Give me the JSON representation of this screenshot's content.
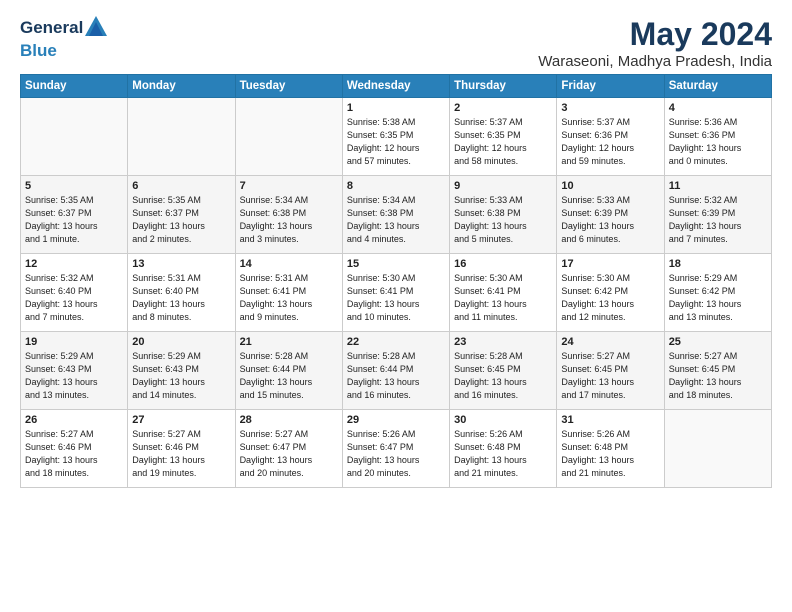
{
  "logo": {
    "line1": "General",
    "line2": "Blue"
  },
  "title": "May 2024",
  "location": "Waraseoni, Madhya Pradesh, India",
  "days_header": [
    "Sunday",
    "Monday",
    "Tuesday",
    "Wednesday",
    "Thursday",
    "Friday",
    "Saturday"
  ],
  "weeks": [
    [
      {
        "num": "",
        "info": ""
      },
      {
        "num": "",
        "info": ""
      },
      {
        "num": "",
        "info": ""
      },
      {
        "num": "1",
        "info": "Sunrise: 5:38 AM\nSunset: 6:35 PM\nDaylight: 12 hours\nand 57 minutes."
      },
      {
        "num": "2",
        "info": "Sunrise: 5:37 AM\nSunset: 6:35 PM\nDaylight: 12 hours\nand 58 minutes."
      },
      {
        "num": "3",
        "info": "Sunrise: 5:37 AM\nSunset: 6:36 PM\nDaylight: 12 hours\nand 59 minutes."
      },
      {
        "num": "4",
        "info": "Sunrise: 5:36 AM\nSunset: 6:36 PM\nDaylight: 13 hours\nand 0 minutes."
      }
    ],
    [
      {
        "num": "5",
        "info": "Sunrise: 5:35 AM\nSunset: 6:37 PM\nDaylight: 13 hours\nand 1 minute."
      },
      {
        "num": "6",
        "info": "Sunrise: 5:35 AM\nSunset: 6:37 PM\nDaylight: 13 hours\nand 2 minutes."
      },
      {
        "num": "7",
        "info": "Sunrise: 5:34 AM\nSunset: 6:38 PM\nDaylight: 13 hours\nand 3 minutes."
      },
      {
        "num": "8",
        "info": "Sunrise: 5:34 AM\nSunset: 6:38 PM\nDaylight: 13 hours\nand 4 minutes."
      },
      {
        "num": "9",
        "info": "Sunrise: 5:33 AM\nSunset: 6:38 PM\nDaylight: 13 hours\nand 5 minutes."
      },
      {
        "num": "10",
        "info": "Sunrise: 5:33 AM\nSunset: 6:39 PM\nDaylight: 13 hours\nand 6 minutes."
      },
      {
        "num": "11",
        "info": "Sunrise: 5:32 AM\nSunset: 6:39 PM\nDaylight: 13 hours\nand 7 minutes."
      }
    ],
    [
      {
        "num": "12",
        "info": "Sunrise: 5:32 AM\nSunset: 6:40 PM\nDaylight: 13 hours\nand 7 minutes."
      },
      {
        "num": "13",
        "info": "Sunrise: 5:31 AM\nSunset: 6:40 PM\nDaylight: 13 hours\nand 8 minutes."
      },
      {
        "num": "14",
        "info": "Sunrise: 5:31 AM\nSunset: 6:41 PM\nDaylight: 13 hours\nand 9 minutes."
      },
      {
        "num": "15",
        "info": "Sunrise: 5:30 AM\nSunset: 6:41 PM\nDaylight: 13 hours\nand 10 minutes."
      },
      {
        "num": "16",
        "info": "Sunrise: 5:30 AM\nSunset: 6:41 PM\nDaylight: 13 hours\nand 11 minutes."
      },
      {
        "num": "17",
        "info": "Sunrise: 5:30 AM\nSunset: 6:42 PM\nDaylight: 13 hours\nand 12 minutes."
      },
      {
        "num": "18",
        "info": "Sunrise: 5:29 AM\nSunset: 6:42 PM\nDaylight: 13 hours\nand 13 minutes."
      }
    ],
    [
      {
        "num": "19",
        "info": "Sunrise: 5:29 AM\nSunset: 6:43 PM\nDaylight: 13 hours\nand 13 minutes."
      },
      {
        "num": "20",
        "info": "Sunrise: 5:29 AM\nSunset: 6:43 PM\nDaylight: 13 hours\nand 14 minutes."
      },
      {
        "num": "21",
        "info": "Sunrise: 5:28 AM\nSunset: 6:44 PM\nDaylight: 13 hours\nand 15 minutes."
      },
      {
        "num": "22",
        "info": "Sunrise: 5:28 AM\nSunset: 6:44 PM\nDaylight: 13 hours\nand 16 minutes."
      },
      {
        "num": "23",
        "info": "Sunrise: 5:28 AM\nSunset: 6:45 PM\nDaylight: 13 hours\nand 16 minutes."
      },
      {
        "num": "24",
        "info": "Sunrise: 5:27 AM\nSunset: 6:45 PM\nDaylight: 13 hours\nand 17 minutes."
      },
      {
        "num": "25",
        "info": "Sunrise: 5:27 AM\nSunset: 6:45 PM\nDaylight: 13 hours\nand 18 minutes."
      }
    ],
    [
      {
        "num": "26",
        "info": "Sunrise: 5:27 AM\nSunset: 6:46 PM\nDaylight: 13 hours\nand 18 minutes."
      },
      {
        "num": "27",
        "info": "Sunrise: 5:27 AM\nSunset: 6:46 PM\nDaylight: 13 hours\nand 19 minutes."
      },
      {
        "num": "28",
        "info": "Sunrise: 5:27 AM\nSunset: 6:47 PM\nDaylight: 13 hours\nand 20 minutes."
      },
      {
        "num": "29",
        "info": "Sunrise: 5:26 AM\nSunset: 6:47 PM\nDaylight: 13 hours\nand 20 minutes."
      },
      {
        "num": "30",
        "info": "Sunrise: 5:26 AM\nSunset: 6:48 PM\nDaylight: 13 hours\nand 21 minutes."
      },
      {
        "num": "31",
        "info": "Sunrise: 5:26 AM\nSunset: 6:48 PM\nDaylight: 13 hours\nand 21 minutes."
      },
      {
        "num": "",
        "info": ""
      }
    ]
  ]
}
